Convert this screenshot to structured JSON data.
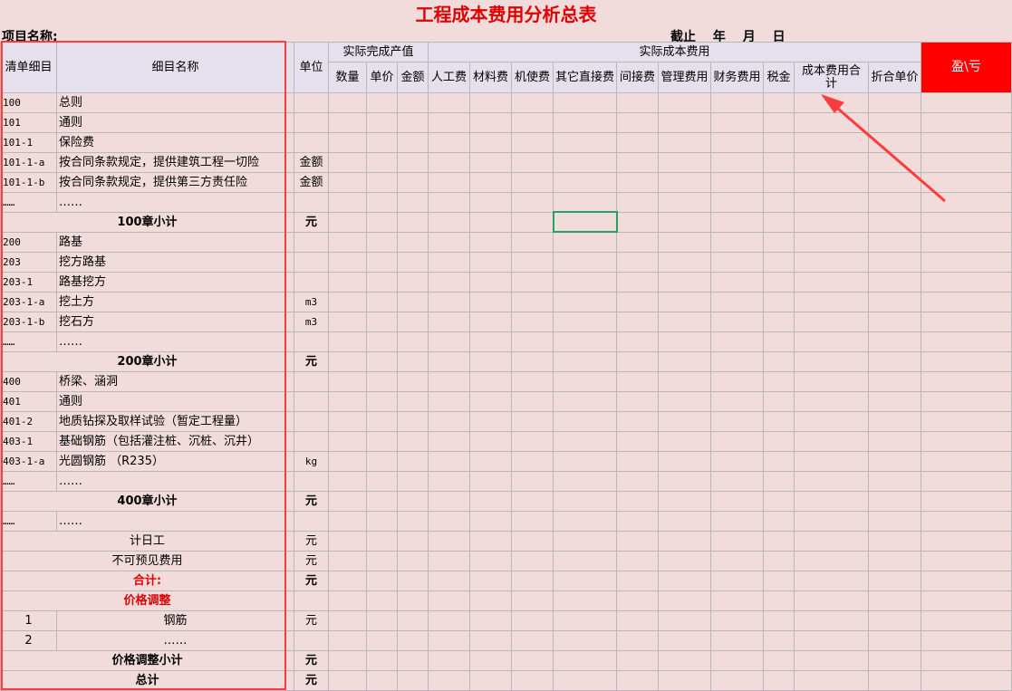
{
  "title": "工程成本费用分析总表",
  "project_label": "项目名称:",
  "as_of": "截止 年 月 日",
  "header": {
    "code": "清单细目",
    "name": "细目名称",
    "unit": "单位",
    "actual_output": "实际完成产值",
    "actual_cost": "实际成本费用",
    "profit_loss": "盈\\亏",
    "sub": [
      "数量",
      "单价",
      "金额",
      "人工费",
      "材料费",
      "机使费",
      "其它直接费",
      "间接费",
      "管理费用",
      "财务费用",
      "税金",
      "成本费用合计",
      "折合单价"
    ]
  },
  "rows": [
    {
      "code": "100",
      "name": "总则",
      "unit": ""
    },
    {
      "code": "101",
      "name": "通则",
      "unit": ""
    },
    {
      "code": "101-1",
      "name": "保险费",
      "unit": ""
    },
    {
      "code": "101-1-a",
      "name": "按合同条款规定，提供建筑工程一切险",
      "unit": "金额"
    },
    {
      "code": "101-1-b",
      "name": "按合同条款规定，提供第三方责任险",
      "unit": "金额"
    },
    {
      "code": "……",
      "name": "……",
      "unit": ""
    },
    {
      "merged": "100章小计",
      "unit": "元",
      "style": "b"
    },
    {
      "code": "200",
      "name": "路基",
      "unit": ""
    },
    {
      "code": "203",
      "name": "挖方路基",
      "unit": ""
    },
    {
      "code": "203-1",
      "name": "路基挖方",
      "unit": ""
    },
    {
      "code": "203-1-a",
      "name": "挖土方",
      "unit": "m3"
    },
    {
      "code": "203-1-b",
      "name": "挖石方",
      "unit": "m3"
    },
    {
      "code": "……",
      "name": "……",
      "unit": ""
    },
    {
      "merged": "200章小计",
      "unit": "元",
      "style": "b"
    },
    {
      "code": "400",
      "name": "桥梁、涵洞",
      "unit": ""
    },
    {
      "code": "401",
      "name": "通则",
      "unit": ""
    },
    {
      "code": "401-2",
      "name": "地质钻探及取样试验（暂定工程量）",
      "unit": ""
    },
    {
      "code": "403-1",
      "name": "基础钢筋（包括灌注桩、沉桩、沉井）",
      "unit": ""
    },
    {
      "code": "403-1-a",
      "name": "光圆钢筋 （R235）",
      "unit": "kg"
    },
    {
      "code": "……",
      "name": "……",
      "unit": ""
    },
    {
      "merged": "400章小计",
      "unit": "元",
      "style": "b"
    },
    {
      "code": "……",
      "name": "……",
      "unit": ""
    },
    {
      "merged": "计日工",
      "unit": "元",
      "style": ""
    },
    {
      "merged": "不可预见费用",
      "unit": "元",
      "style": ""
    },
    {
      "merged": "合计:",
      "unit": "元",
      "style": "r"
    },
    {
      "merged": "价格调整",
      "unit": "",
      "style": "r"
    },
    {
      "code": "1",
      "name": "钢筋",
      "unit": "元",
      "style": "c"
    },
    {
      "code": "2",
      "name": "……",
      "unit": "",
      "style": "c"
    },
    {
      "merged": "价格调整小计",
      "unit": "元",
      "style": "b"
    },
    {
      "merged": "总计",
      "unit": "元",
      "style": "b"
    }
  ]
}
